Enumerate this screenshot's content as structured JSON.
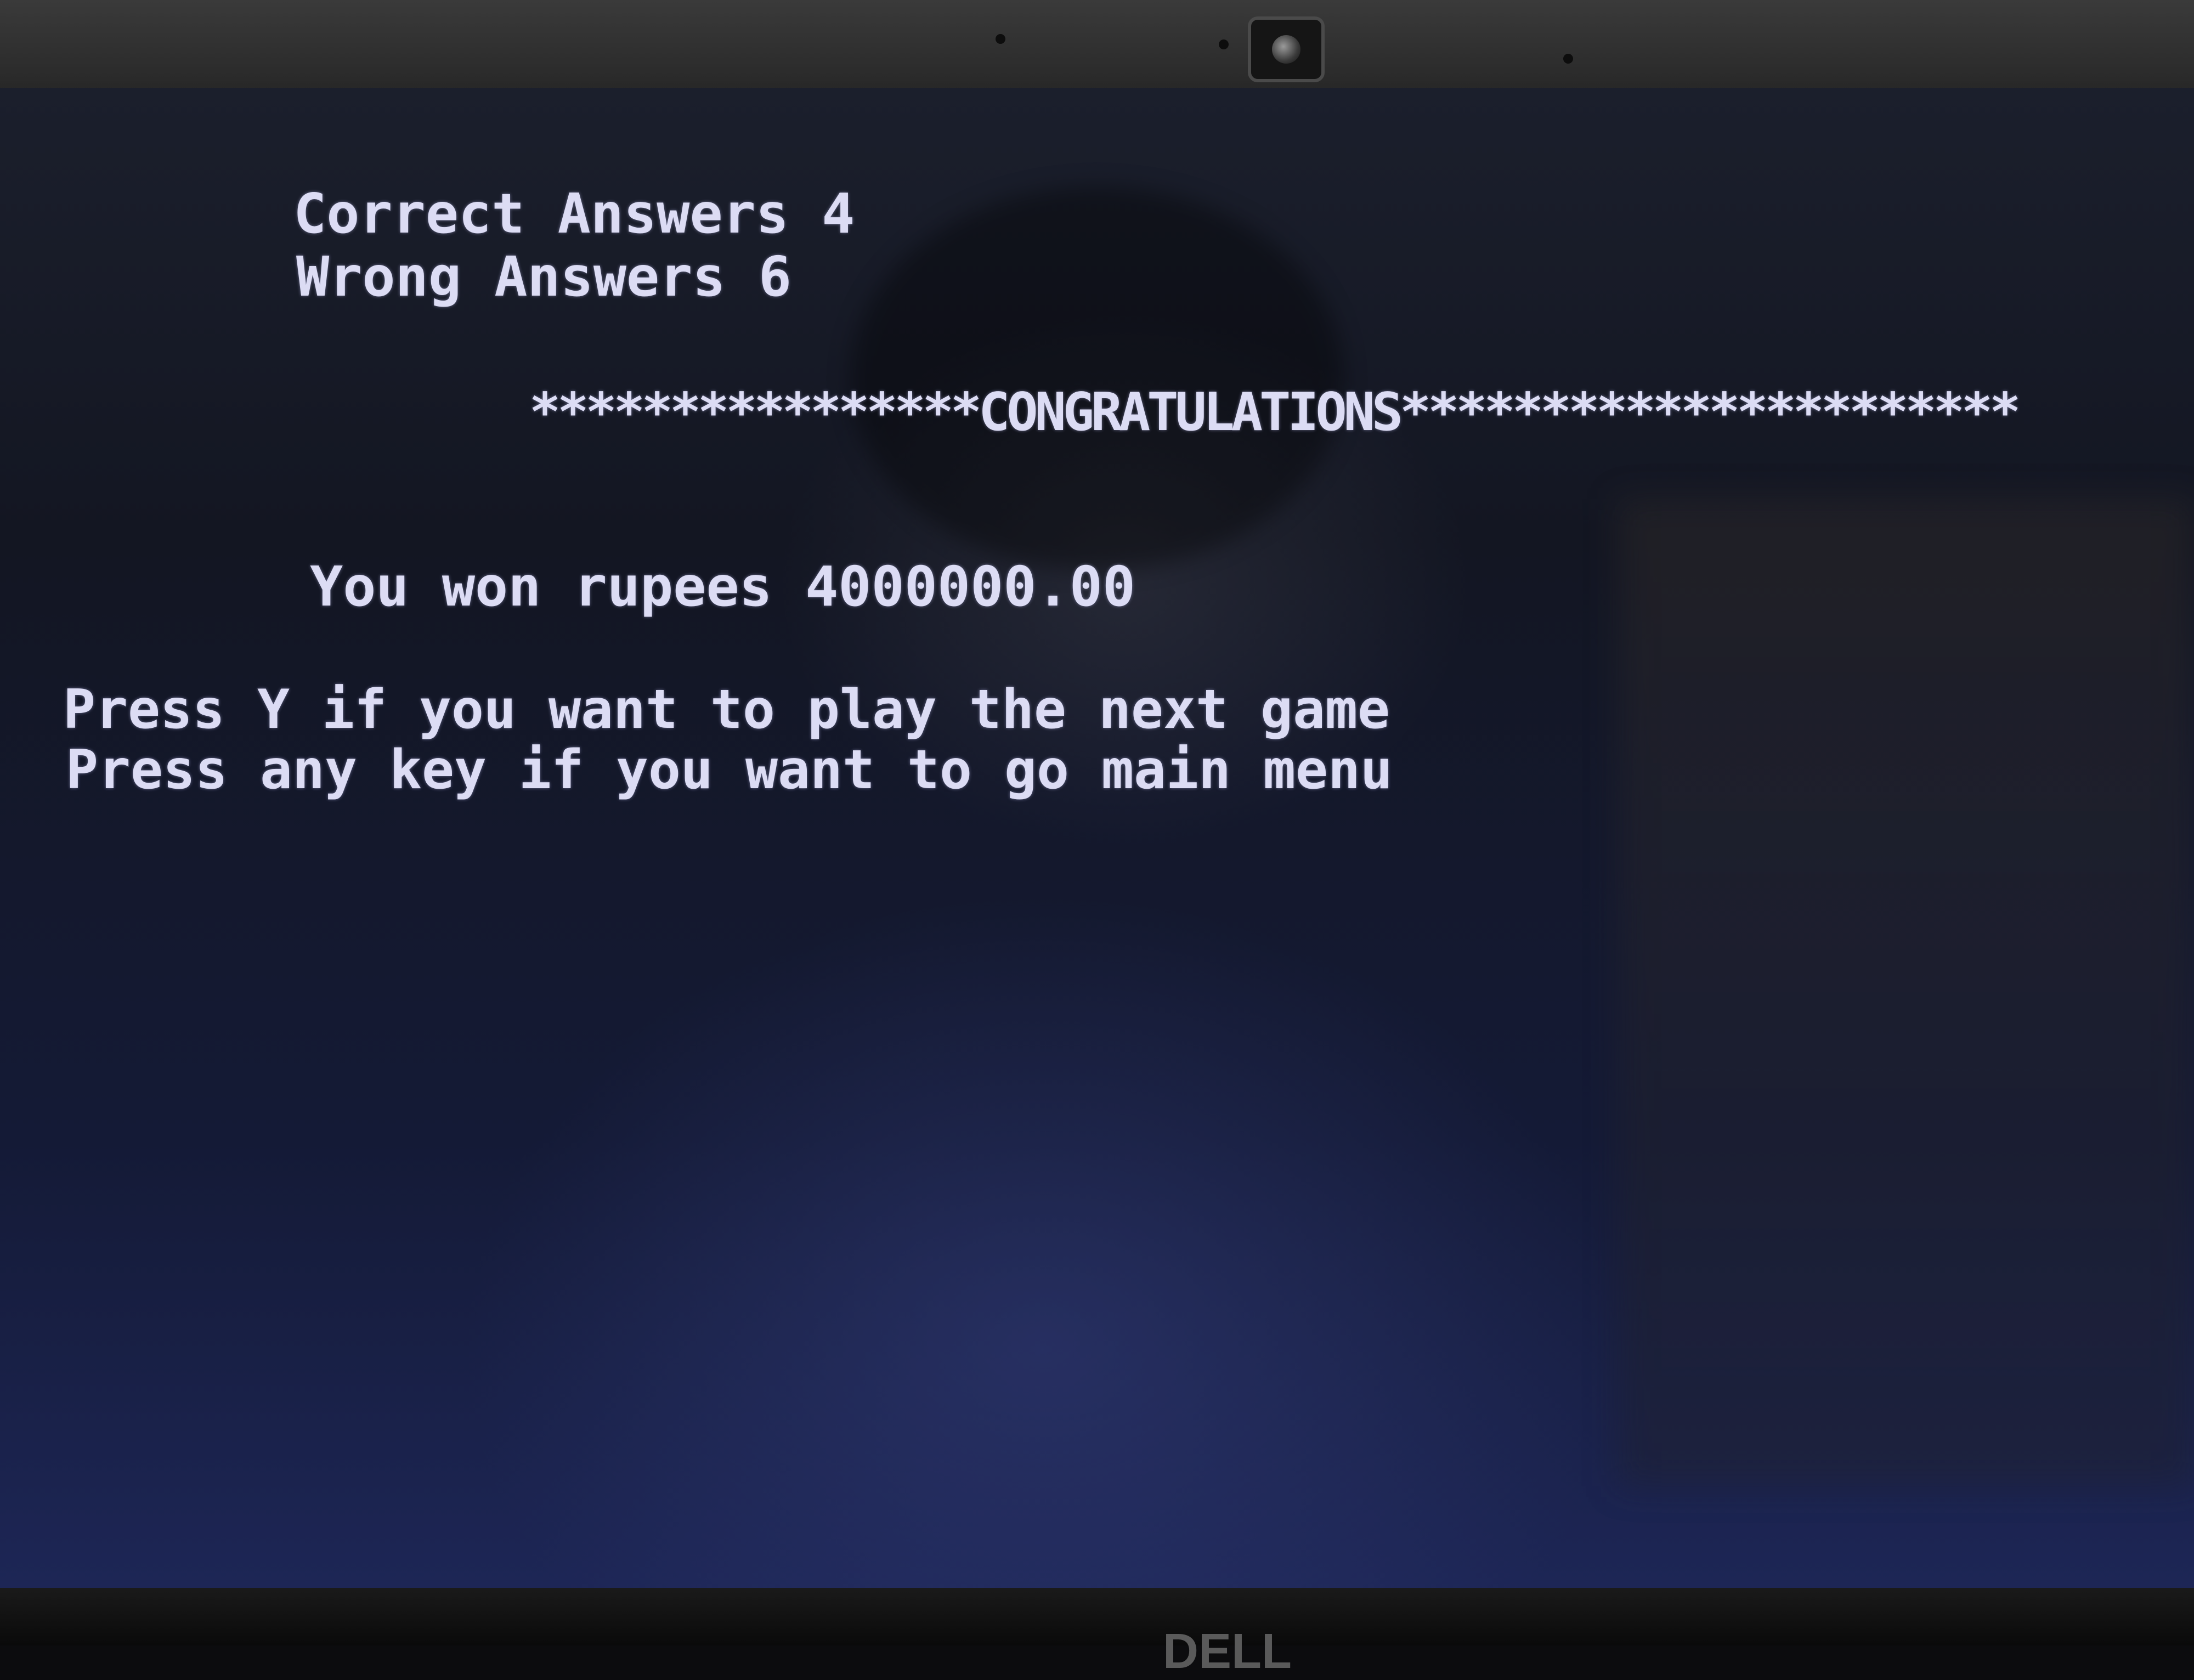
{
  "screen": {
    "correct_answers": "Correct Answers 4",
    "wrong_answers": "Wrong Answers 6",
    "congratulations": "****************CONGRATULATIONS**********************",
    "winnings": "You won rupees 4000000.00",
    "prompt_next_game": "Press Y if you want to play the next game",
    "prompt_main_menu": "Press any key if you want to go main menu"
  },
  "bezel": {
    "brand_logo": "DELL"
  },
  "colors": {
    "text": "#dcdcf4",
    "screen_bg": "#141a36"
  }
}
